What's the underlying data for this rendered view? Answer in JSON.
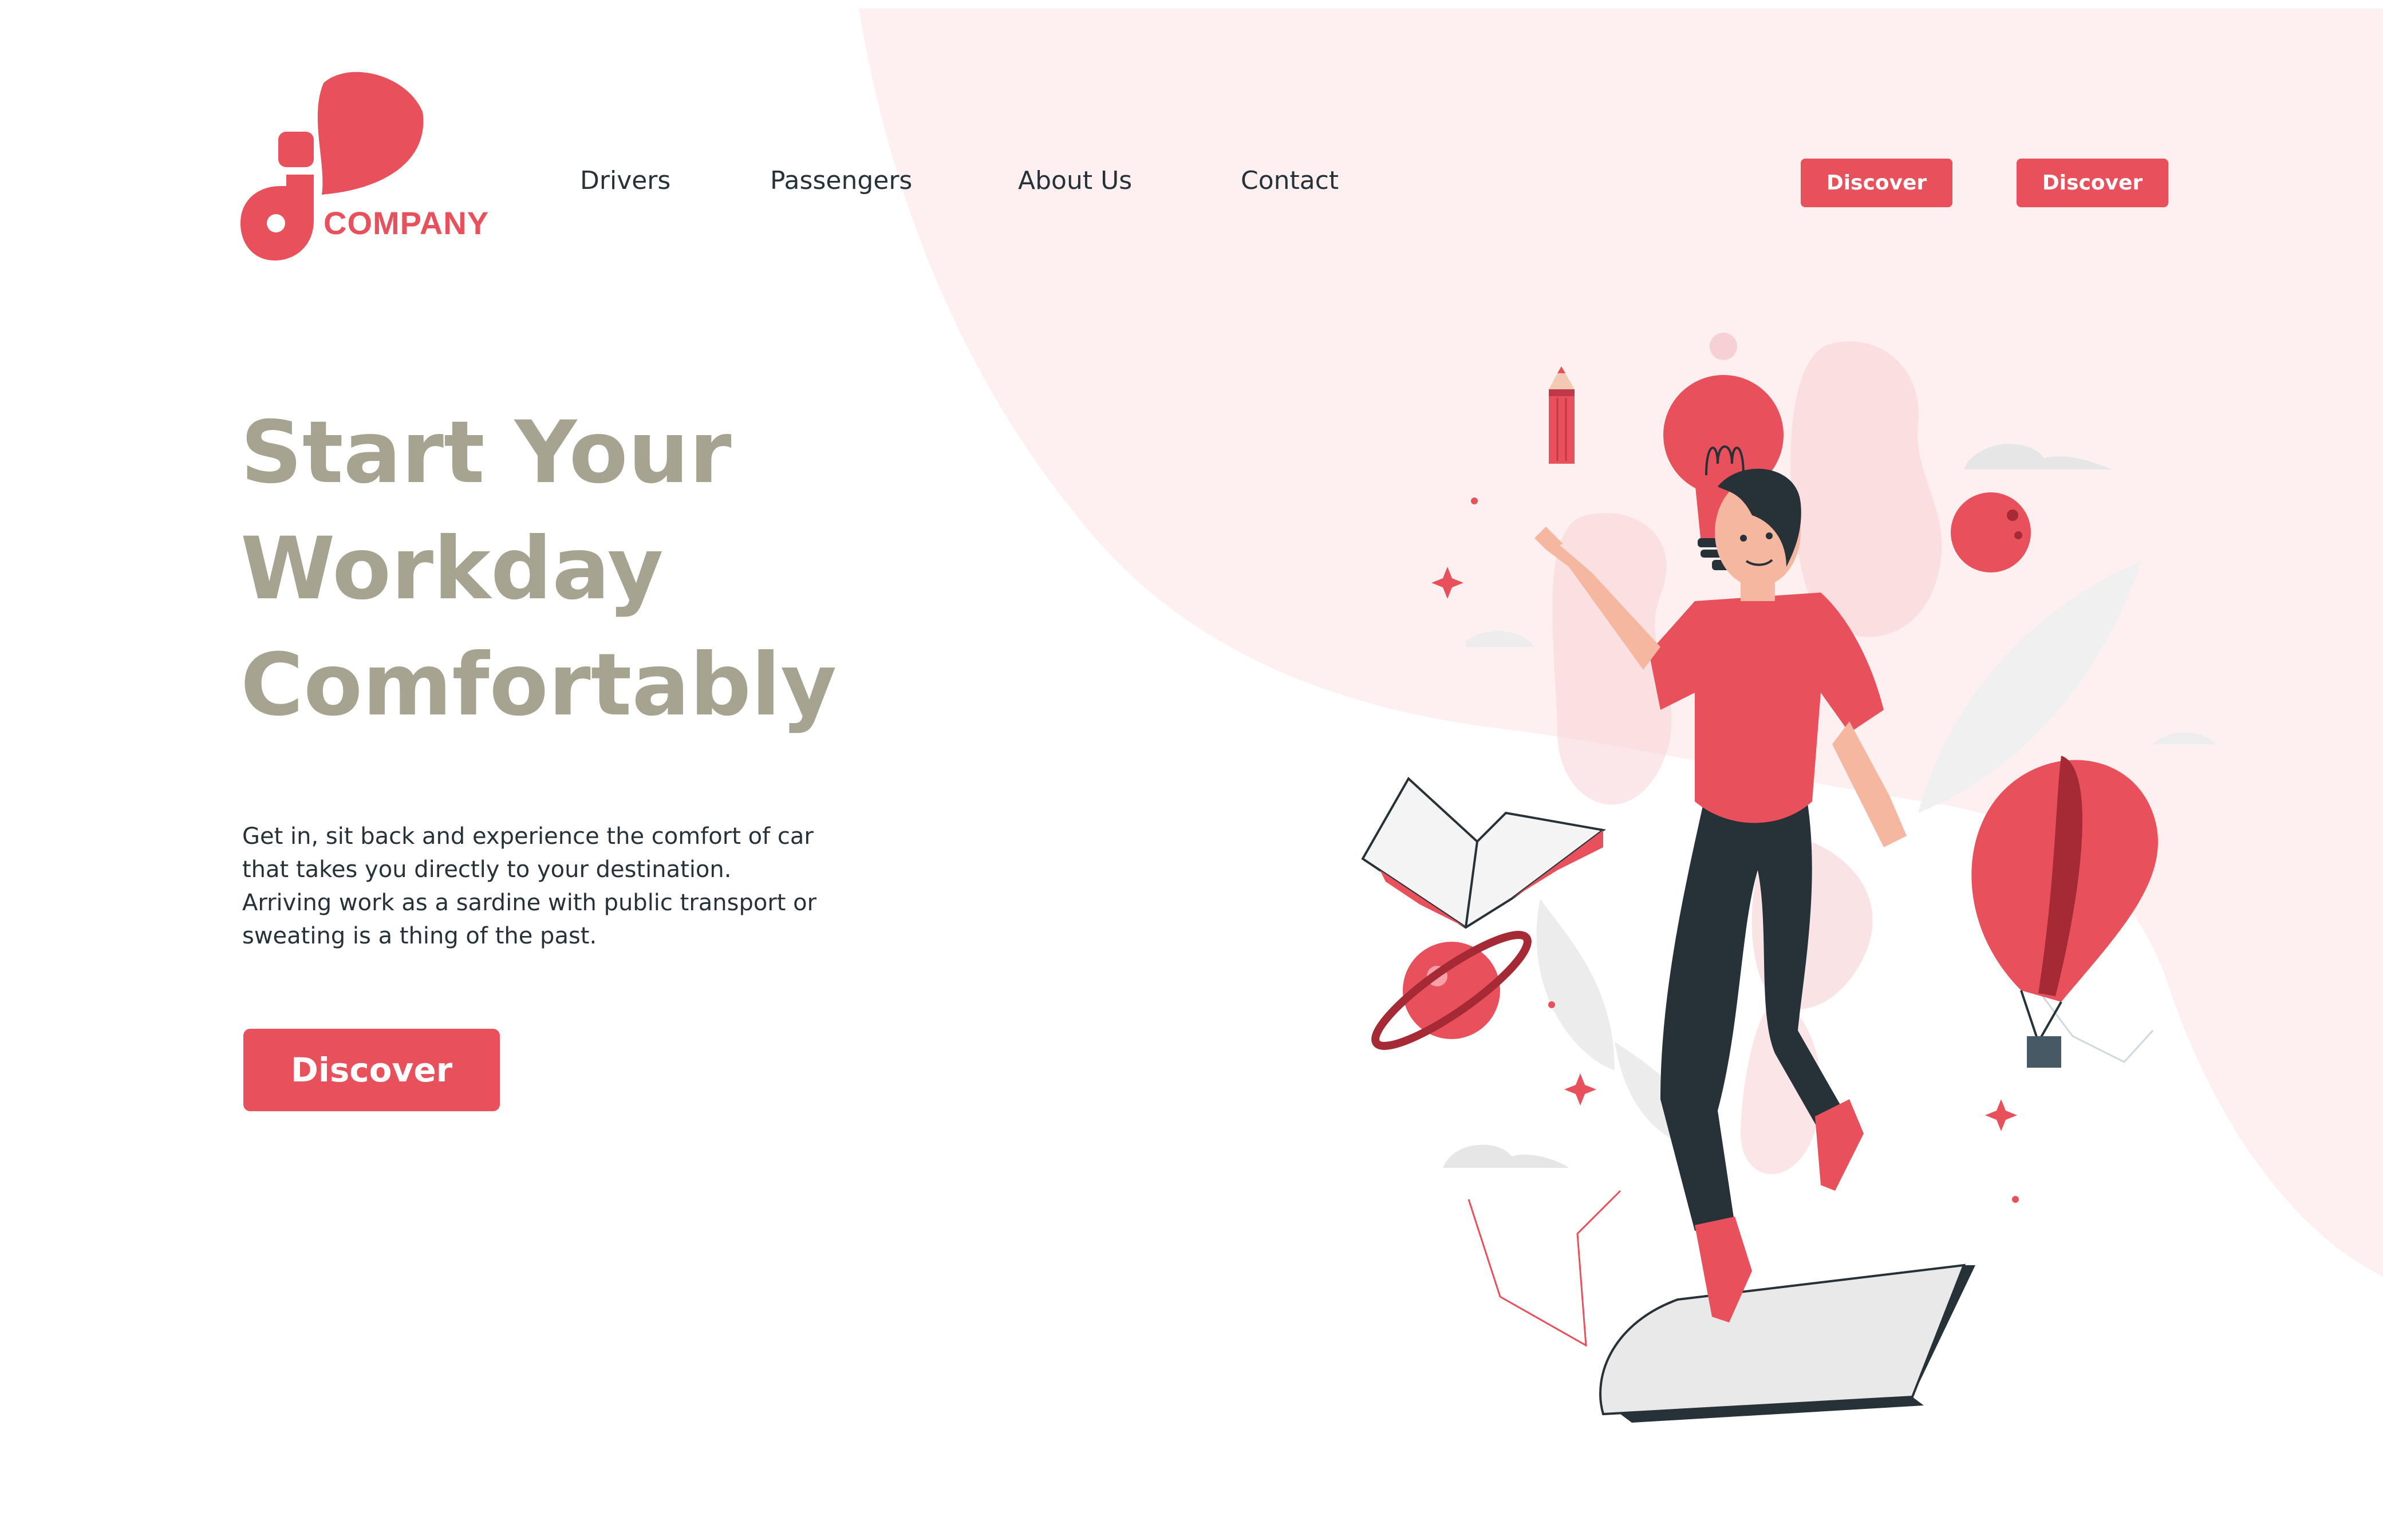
{
  "brand": {
    "name": "COMPANY",
    "color": "#e8505b"
  },
  "nav": {
    "items": [
      {
        "label": "Drivers"
      },
      {
        "label": "Passengers"
      },
      {
        "label": "About Us"
      },
      {
        "label": "Contact"
      }
    ]
  },
  "header_buttons": [
    {
      "label": "Discover"
    },
    {
      "label": "Discover"
    }
  ],
  "hero": {
    "title_lines": [
      "Start Your",
      "Workday",
      "Comfortably"
    ],
    "description_lines": [
      "Get in, sit back and experience the comfort of car",
      "that takes you directly to your destination.",
      "Arriving work as a sardine with public transport or",
      "sweating is a thing of the past."
    ],
    "cta_label": "Discover"
  },
  "colors": {
    "accent": "#e8505b",
    "title": "#a6a391",
    "text": "#263238",
    "blob": "#fef0f0"
  },
  "icons": {
    "illustration": "person-floating-with-lightbulb-book-planet-balloon-illustration"
  }
}
